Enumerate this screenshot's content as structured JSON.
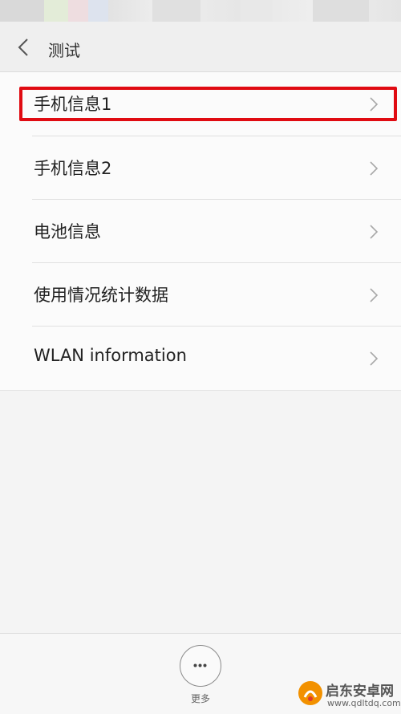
{
  "header": {
    "back_icon": "chevron-left-icon",
    "title": "测试"
  },
  "list": {
    "items": [
      {
        "label": "手机信息1",
        "icon": "chevron-right-icon",
        "highlighted": true
      },
      {
        "label": "手机信息2",
        "icon": "chevron-right-icon"
      },
      {
        "label": "电池信息",
        "icon": "chevron-right-icon"
      },
      {
        "label": "使用情况统计数据",
        "icon": "chevron-right-icon"
      },
      {
        "label": "WLAN information",
        "icon": "chevron-right-icon"
      }
    ]
  },
  "bottom_bar": {
    "more_icon": "more-dots-icon",
    "more_label": "更多"
  },
  "watermark": {
    "name": "启东安卓网",
    "url": "www.qdltdq.com"
  },
  "colors": {
    "highlight_border": "#e00b12",
    "background": "#f4f4f4",
    "list_background": "#fbfbfb"
  }
}
